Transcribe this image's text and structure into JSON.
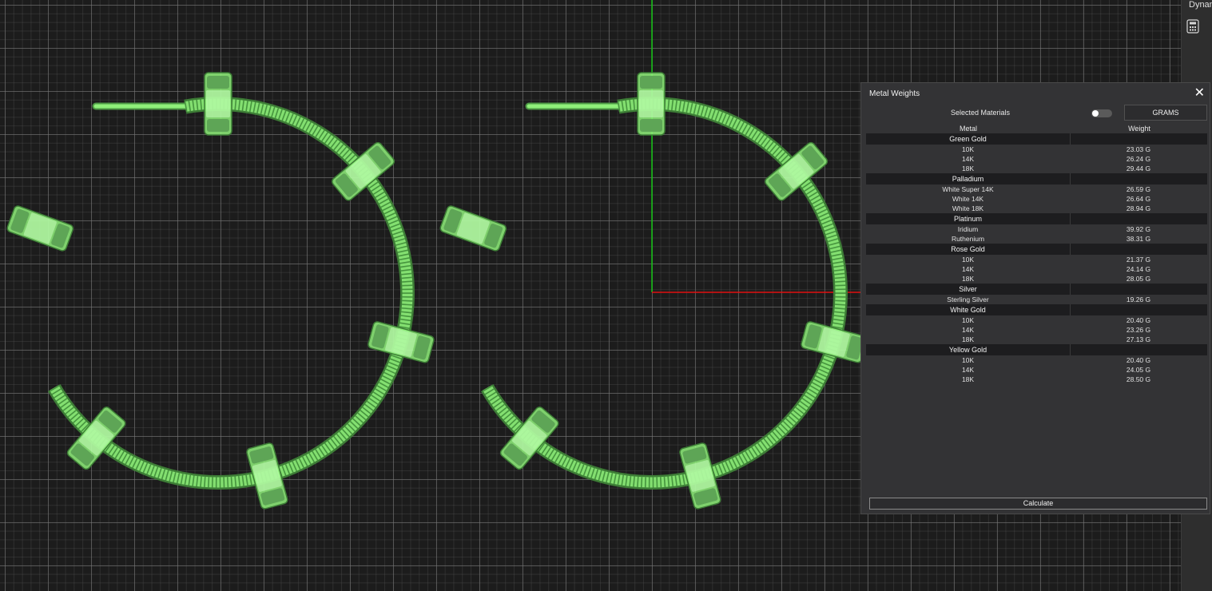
{
  "right_panel": {
    "label": "Dynam",
    "icon": "calculator-icon"
  },
  "metal_weights": {
    "title": "Metal Weights",
    "close_icon": "close-icon",
    "selected_materials_label": "Selected Materials",
    "selected_materials_toggle": false,
    "unit_button": "GRAMS",
    "columns": {
      "metal": "Metal",
      "weight": "Weight"
    },
    "groups": [
      {
        "name": "Green Gold",
        "items": [
          {
            "metal": "10K",
            "weight": "23.03 G"
          },
          {
            "metal": "14K",
            "weight": "26.24 G"
          },
          {
            "metal": "18K",
            "weight": "29.44 G"
          }
        ]
      },
      {
        "name": "Palladium",
        "items": [
          {
            "metal": "White Super 14K",
            "weight": "26.59 G"
          },
          {
            "metal": "White 14K",
            "weight": "26.64 G"
          },
          {
            "metal": "White 18K",
            "weight": "28.94 G"
          }
        ]
      },
      {
        "name": "Platinum",
        "items": [
          {
            "metal": "Iridium",
            "weight": "39.92 G"
          },
          {
            "metal": "Ruthenium",
            "weight": "38.31 G"
          }
        ]
      },
      {
        "name": "Rose Gold",
        "items": [
          {
            "metal": "10K",
            "weight": "21.37 G"
          },
          {
            "metal": "14K",
            "weight": "24.14 G"
          },
          {
            "metal": "18K",
            "weight": "28.05 G"
          }
        ]
      },
      {
        "name": "Silver",
        "items": [
          {
            "metal": "Sterling Silver",
            "weight": "19.26 G"
          }
        ]
      },
      {
        "name": "White Gold",
        "items": [
          {
            "metal": "10K",
            "weight": "20.40 G"
          },
          {
            "metal": "14K",
            "weight": "23.26 G"
          },
          {
            "metal": "18K",
            "weight": "27.13 G"
          }
        ]
      },
      {
        "name": "Yellow Gold",
        "items": [
          {
            "metal": "10K",
            "weight": "20.40 G"
          },
          {
            "metal": "14K",
            "weight": "24.05 G"
          },
          {
            "metal": "18K",
            "weight": "28.50 G"
          }
        ]
      }
    ],
    "calculate_button": "Calculate"
  },
  "colors": {
    "model": "#8ff07a",
    "x_axis": "#e01010",
    "y_axis": "#10c010",
    "panel_bg": "#333335"
  }
}
